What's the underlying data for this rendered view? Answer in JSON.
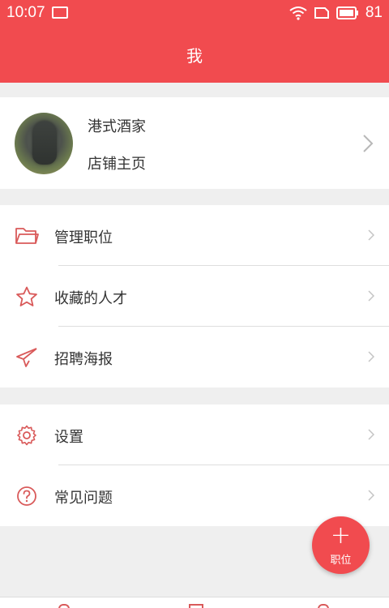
{
  "status_bar": {
    "time": "10:07",
    "battery": "81"
  },
  "header": {
    "title": "我"
  },
  "profile": {
    "name": "港式酒家",
    "subtitle": "店铺主页"
  },
  "menu": {
    "manage_positions": "管理职位",
    "saved_talents": "收藏的人才",
    "recruit_poster": "招聘海报",
    "settings": "设置",
    "faq": "常见问题"
  },
  "fab": {
    "plus": "+",
    "label": "职位"
  },
  "colors": {
    "accent": "#f14b4f",
    "background": "#efefef",
    "icon": "#d95a5a"
  }
}
